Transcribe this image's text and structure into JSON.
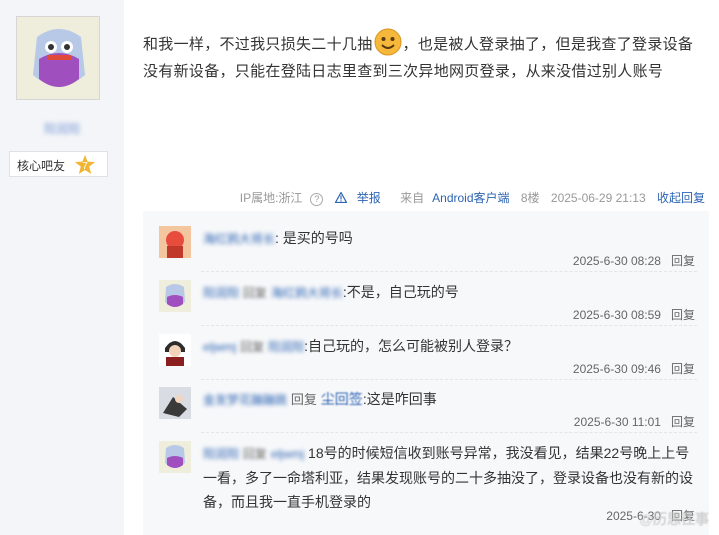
{
  "post": {
    "author_badge": "核心吧友",
    "author_level": "7",
    "text_part1": "和我一样，不过我只损失二十几抽",
    "text_part2": "，也是被人登录抽了，但是我查了登录设备没有新设备，只能在登陆日志里查到三次异地网页登录，从来没借过别人账号",
    "emoji": "smile-emoji",
    "meta": {
      "ip": "IP属地:浙江",
      "report": "举报",
      "client_prefix": "来自",
      "client": "Android客户端",
      "floor": "8楼",
      "time": "2025-06-29 21:13",
      "fold": "收起回复"
    }
  },
  "replies": [
    {
      "text": ": 是买的号吗",
      "time": "2025-6-30 08:28",
      "action": "回复"
    },
    {
      "reply_word": "回复",
      "text": ":不是，自己玩的号",
      "time": "2025-6-30 08:59",
      "action": "回复"
    },
    {
      "reply_word": "回复",
      "text": ":自己玩的，怎么可能被别人登录？",
      "time": "2025-6-30 09:46",
      "action": "回复"
    },
    {
      "reply_word": "回复",
      "target": "尘回签",
      "text": ":这是咋回事",
      "time": "2025-6-30 11:01",
      "action": "回复"
    },
    {
      "reply_word": "回复",
      "text": "18号的时候短信收到账号异常，我没看见，结果22号晚上上号一看，多了一命塔利亚，结果发现账号的二十多抽没了，登录设备也没有新的设备，而且我一直手机登录的",
      "time": "2025-6-30",
      "action": "回复"
    }
  ],
  "watermark": "@历思往事",
  "colors": {
    "link": "#2d64b3",
    "sidebar": "#f3f5f8",
    "replybg": "#f7f8fa"
  }
}
